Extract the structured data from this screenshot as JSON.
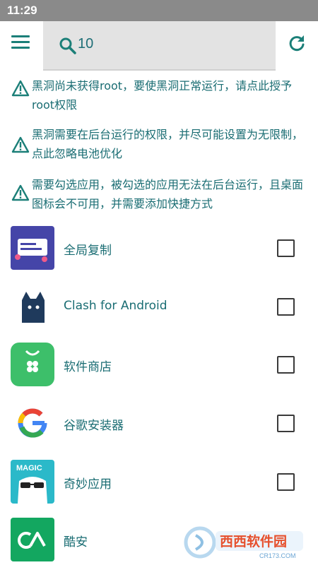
{
  "status_bar": {
    "time": "11:29"
  },
  "toolbar": {
    "menu_icon": "hamburger-menu-icon",
    "search_icon": "search-icon",
    "search_value": "10",
    "refresh_icon": "refresh-icon"
  },
  "warnings": [
    {
      "icon": "warning-icon",
      "text": "黑洞尚未获得root，要使黑洞正常运行，请点此授予root权限"
    },
    {
      "icon": "warning-icon",
      "text": "黑洞需要在后台运行的权限，并尽可能设置为无限制，点此忽略电池优化"
    },
    {
      "icon": "warning-icon",
      "text": "需要勾选应用，被勾选的应用无法在后台运行，且桌面图标会不可用，并需要添加快捷方式"
    }
  ],
  "apps": [
    {
      "name": "全局复制",
      "checked": false
    },
    {
      "name": "Clash for Android",
      "checked": false
    },
    {
      "name": "软件商店",
      "checked": false
    },
    {
      "name": "谷歌安装器",
      "checked": false
    },
    {
      "name": "奇妙应用",
      "checked": false
    },
    {
      "name": "酷安",
      "checked": false
    }
  ],
  "magic_icon_text": "MAGIC",
  "watermark": {
    "brand": "西西软件园",
    "url": "CR173.COM"
  },
  "colors": {
    "accent": "#1b7f78",
    "text": "#1a6d73",
    "status_bar": "#8a8a8a",
    "search_bg": "#e3e3e3"
  }
}
